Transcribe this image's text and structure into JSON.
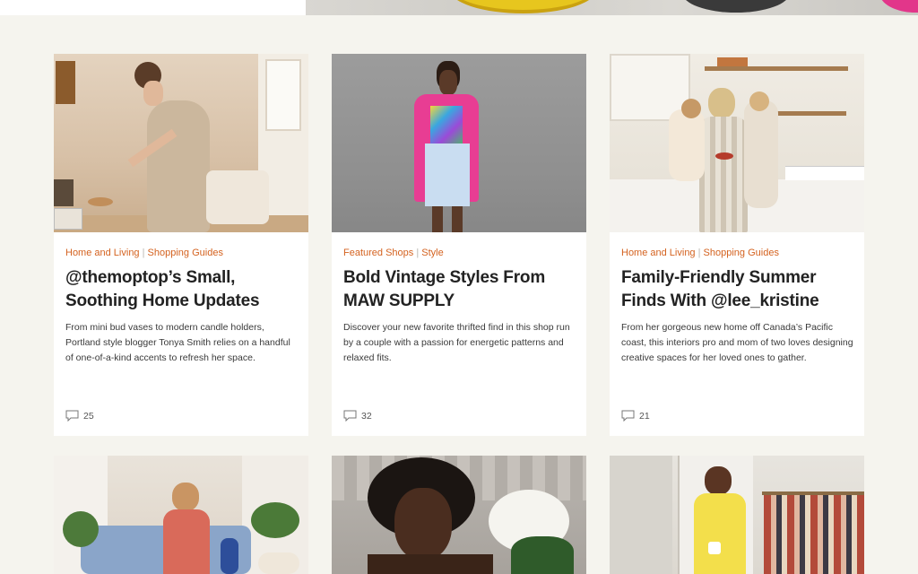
{
  "cards": [
    {
      "categories": [
        "Home and Living",
        "Shopping Guides"
      ],
      "title": "@themoptop’s Small, Soothing Home Updates",
      "description": "From mini bud vases to modern candle holders, Portland style blogger Tonya Smith relies on a handful of one-of-a-kind accents to refresh her space.",
      "comments": "25"
    },
    {
      "categories": [
        "Featured Shops",
        "Style"
      ],
      "title": "Bold Vintage Styles From MAW SUPPLY",
      "description": "Discover your new favorite thrifted find in this shop run by a couple with a passion for energetic patterns and relaxed fits.",
      "comments": "32"
    },
    {
      "categories": [
        "Home and Living",
        "Shopping Guides"
      ],
      "title": "Family-Friendly Summer Finds With @lee_kristine",
      "description": "From her gorgeous new home off Canada’s Pacific coast, this interiors pro and mom of two loves designing creative spaces for her loved ones to gather.",
      "comments": "21"
    }
  ],
  "colors": {
    "page_background": "#f5f4ee",
    "category_accent": "#d4621f",
    "title_text": "#222222"
  },
  "icons": {
    "comment": "speech-bubble-icon"
  }
}
